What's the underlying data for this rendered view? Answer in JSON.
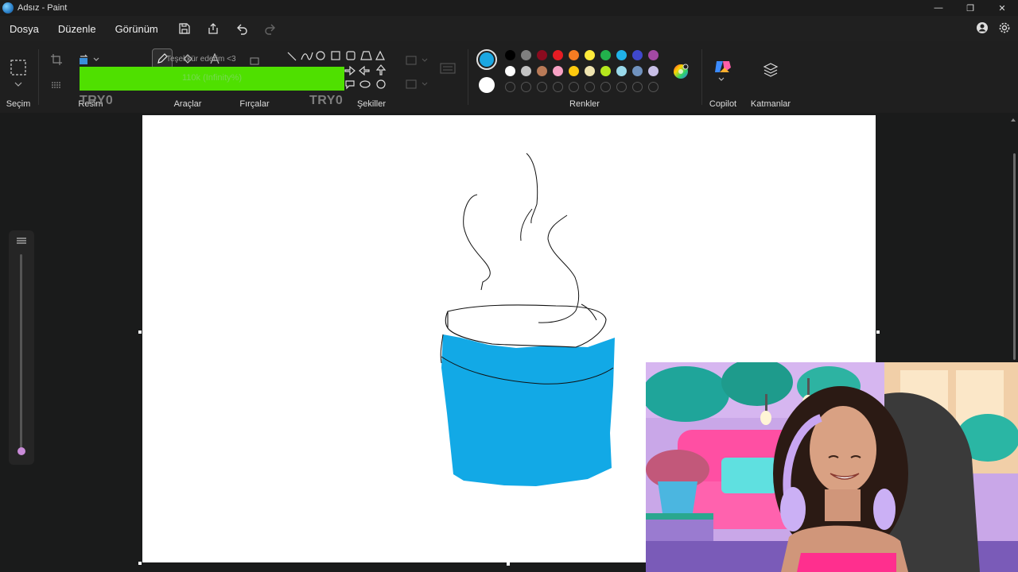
{
  "window": {
    "title": "Adsız - Paint",
    "minimize": "—",
    "restore": "❐",
    "close": "✕"
  },
  "menu": {
    "items": [
      "Dosya",
      "Düzenle",
      "Görünüm"
    ]
  },
  "ribbon": {
    "groups": {
      "selection": "Seçim",
      "image": "Resim",
      "tools": "Araçlar",
      "brushes": "Fırçalar",
      "shapes": "Şekiller",
      "colors": "Renkler",
      "copilot": "Copilot",
      "layers": "Katmanlar"
    },
    "overlay": {
      "thanks": "Teşekkür ederim <3",
      "progress_text": "110k (Infinity%)",
      "watermark": "TRY0"
    },
    "colors": {
      "primary": "#1aa7e2",
      "secondary": "#ffffff",
      "palette_row1": [
        "#000000",
        "#7f7f7f",
        "#8b0b1f",
        "#e51c23",
        "#f57c22",
        "#ffeb3b",
        "#22b14c",
        "#20b2e8",
        "#3f48cc",
        "#a349a4"
      ],
      "palette_row2": [
        "#ffffff",
        "#c3c3c3",
        "#b97a57",
        "#f7a1c4",
        "#ffc90e",
        "#efe4b0",
        "#b5e61d",
        "#99d9ea",
        "#7092be",
        "#c8bfe7"
      ]
    },
    "icons": {
      "selection": "select-rect-icon",
      "crop": "crop-icon",
      "rotate": "rotate-icon",
      "pencil": "pencil-icon",
      "copilot": "copilot-icon",
      "layers": "layers-icon",
      "color_wheel": "color-wheel-icon"
    }
  },
  "drawing": {
    "cup_fill": "#12a9e6",
    "stroke": "#111111"
  }
}
